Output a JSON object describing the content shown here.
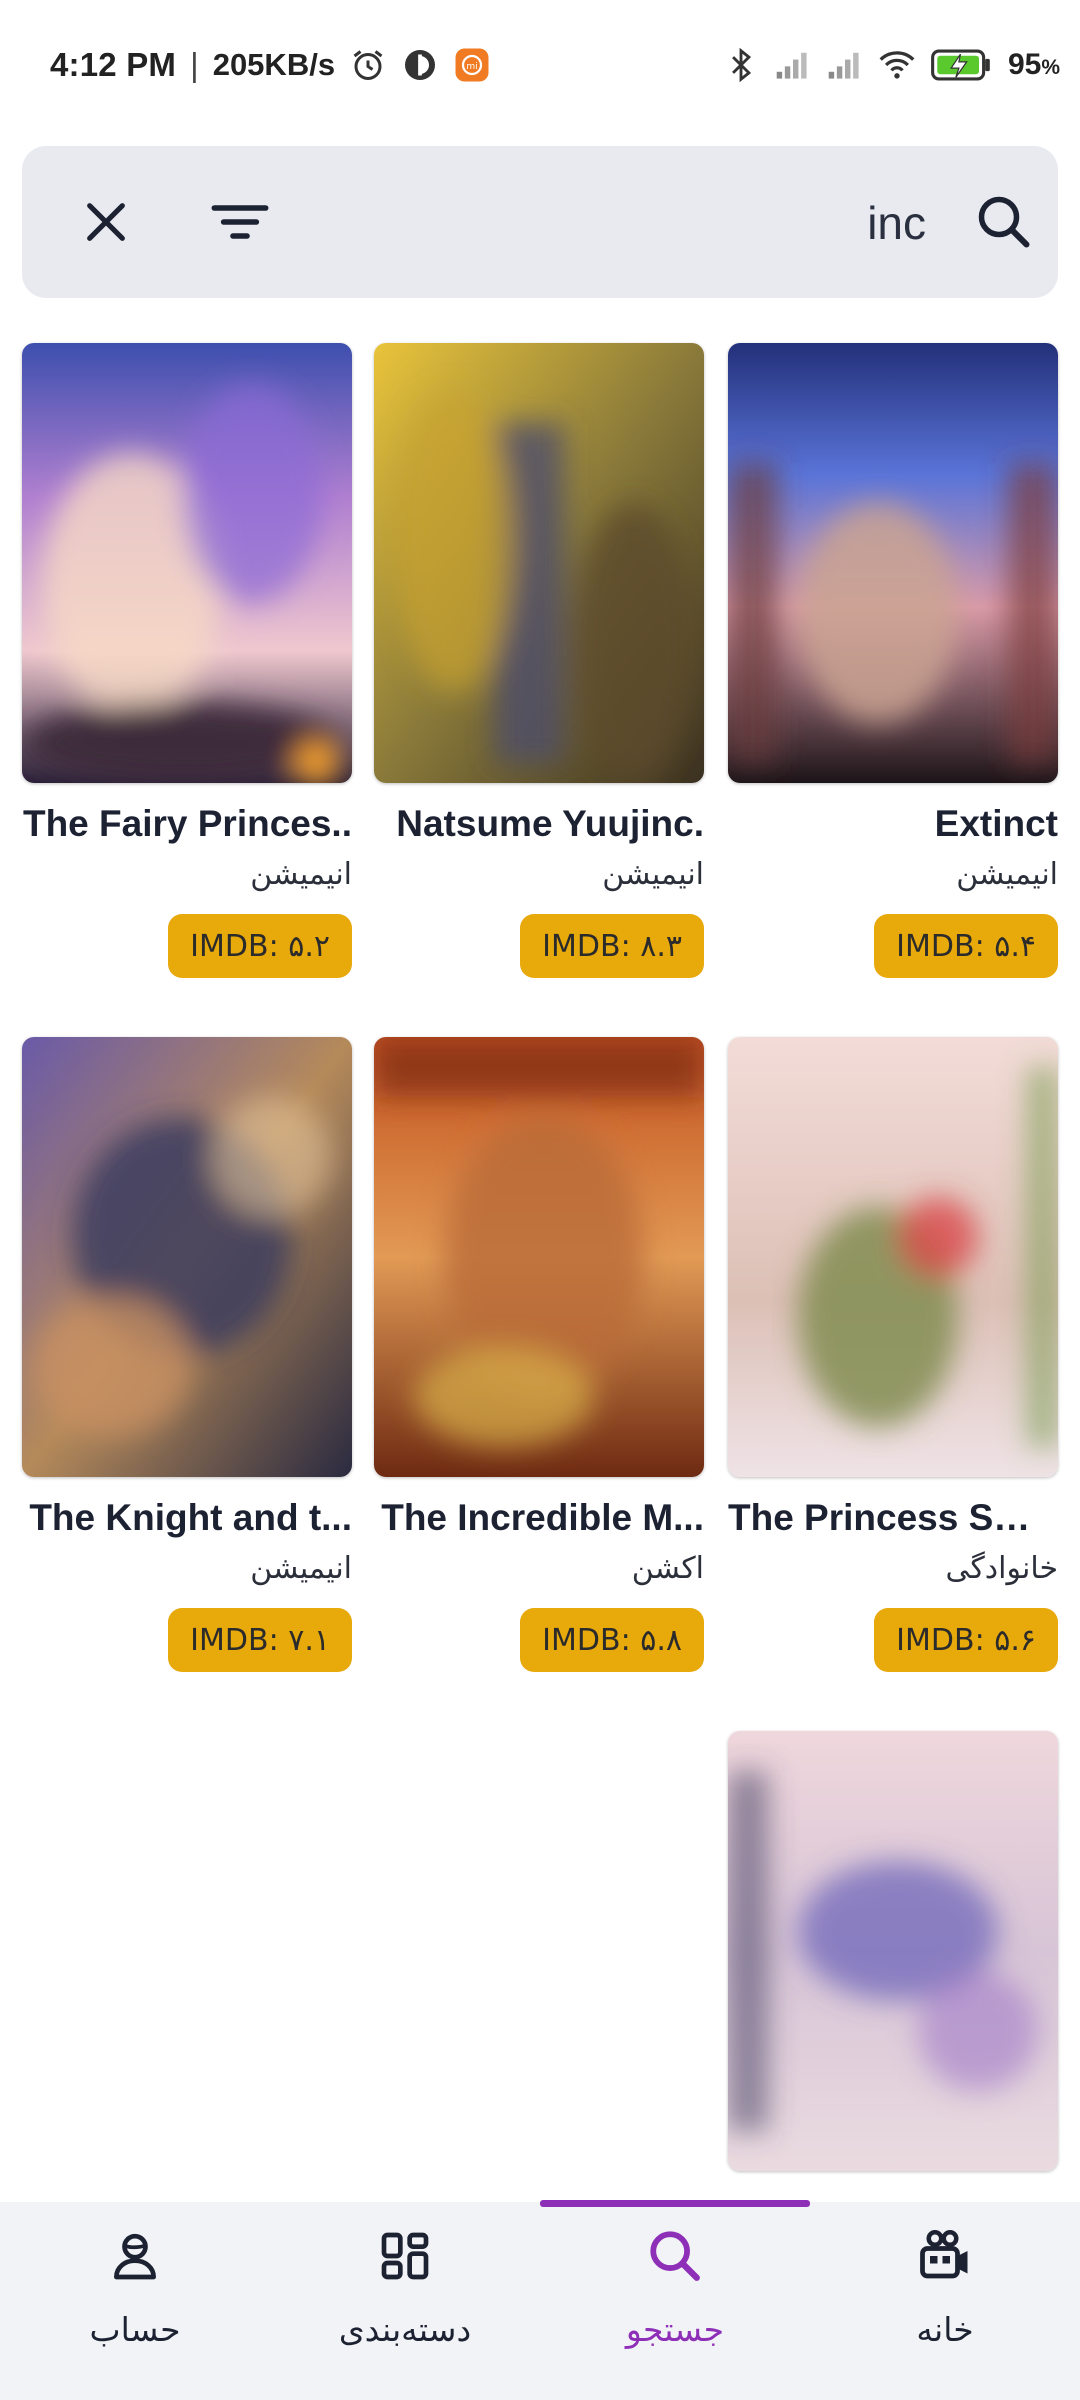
{
  "status_bar": {
    "time": "4:12 PM",
    "separator": "|",
    "net_speed": "205KB/s",
    "battery_pct": "95",
    "battery_unit": "%",
    "icons": [
      "alarm-icon",
      "app-notification-icon",
      "mi-app-icon",
      "bluetooth-icon",
      "signal-icon",
      "signal-icon",
      "wifi-icon",
      "battery-charging-icon"
    ]
  },
  "search": {
    "query": "inc",
    "close_icon": "close-icon",
    "filter_icon": "filter-icon",
    "search_icon": "search-icon"
  },
  "results": [
    {
      "title": "The Fairy Princes..",
      "genre": "انیمیشن",
      "imdb": "IMDB: ۵.۲"
    },
    {
      "title": "Natsume Yuujinc.",
      "genre": "انیمیشن",
      "imdb": "IMDB: ۸.۳"
    },
    {
      "title": "Extinct",
      "genre": "انیمیشن",
      "imdb": "IMDB: ۵.۴"
    },
    {
      "title": "The Knight and t...",
      "genre": "انیمیشن",
      "imdb": "IMDB: ۷.۱"
    },
    {
      "title": "The Incredible M...",
      "genre": "اکشن",
      "imdb": "IMDB: ۵.۸"
    },
    {
      "title": "The Princess Swi...",
      "genre": "خانوادگی",
      "imdb": "IMDB: ۵.۶"
    },
    {
      "title": "",
      "genre": "",
      "imdb": ""
    }
  ],
  "bottom_nav": {
    "items": [
      {
        "label": "حساب",
        "icon": "account-icon",
        "active": false
      },
      {
        "label": "دسته‌بندی",
        "icon": "categories-icon",
        "active": false
      },
      {
        "label": "جستجو",
        "icon": "search-icon",
        "active": true
      },
      {
        "label": "خانه",
        "icon": "home-icon",
        "active": false
      }
    ],
    "active_color": "#8e2fb8"
  },
  "colors": {
    "imdb_badge": "#e8a90b",
    "search_bar_bg": "#e8eaef",
    "nav_bg": "#f2f3f6"
  }
}
